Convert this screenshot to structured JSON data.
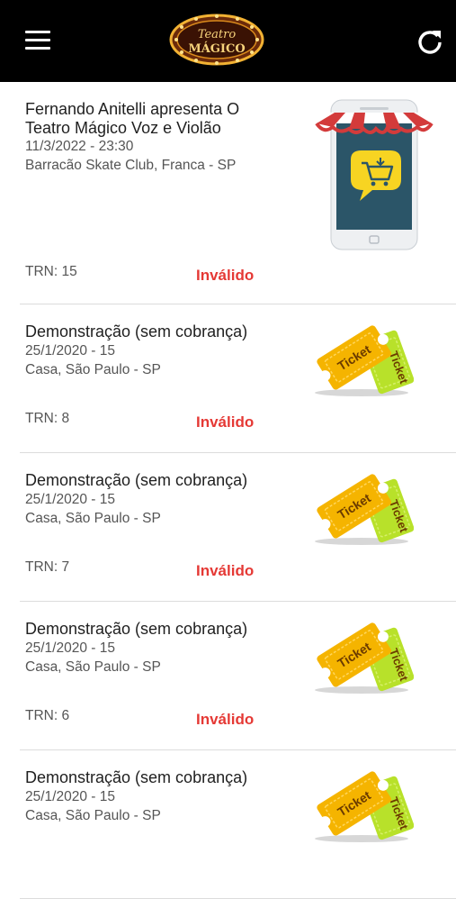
{
  "header": {
    "logo_text_top": "Teatro",
    "logo_text_bottom": "MÁGICO",
    "menu_icon": "hamburger-menu-icon",
    "refresh_icon": "refresh-icon",
    "background": "#000000"
  },
  "tickets": [
    {
      "title": "Fernando Anitelli apresenta O Teatro Mágico Voz e Violão",
      "date": "11/3/2022 - 23:30",
      "venue": "Barracão Skate Club, Franca - SP",
      "trn": "TRN: 15",
      "status": "Inválido",
      "image": "phone-store-icon"
    },
    {
      "title": "Demonstração (sem cobrança)",
      "date": "25/1/2020 - 15",
      "venue": "Casa, São Paulo - SP",
      "trn": "TRN: 8",
      "status": "Inválido",
      "image": "ticket-icon"
    },
    {
      "title": "Demonstração (sem cobrança)",
      "date": "25/1/2020 - 15",
      "venue": "Casa, São Paulo - SP",
      "trn": "TRN: 7",
      "status": "Inválido",
      "image": "ticket-icon"
    },
    {
      "title": "Demonstração (sem cobrança)",
      "date": "25/1/2020 - 15",
      "venue": "Casa, São Paulo - SP",
      "trn": "TRN: 6",
      "status": "Inválido",
      "image": "ticket-icon"
    },
    {
      "title": "Demonstração (sem cobrança)",
      "date": "25/1/2020 - 15",
      "venue": "Casa, São Paulo - SP",
      "image": "ticket-icon"
    }
  ],
  "ticket_art_label": "Ticket",
  "colors": {
    "status_invalid": "#e53935",
    "ticket_orange": "#f5b400",
    "ticket_green": "#b8e12a"
  }
}
